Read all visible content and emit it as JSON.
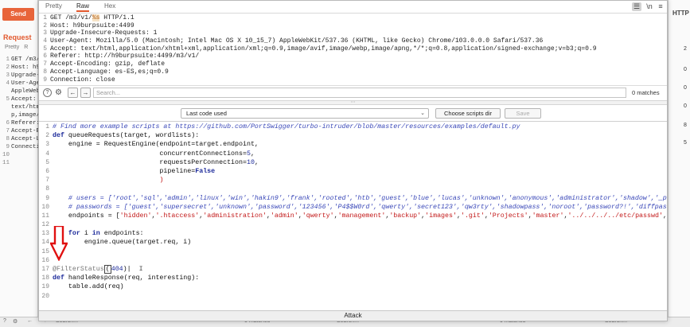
{
  "background": {
    "send_label": "Send",
    "request_label": "Request",
    "tabs": [
      "Pretty",
      "R"
    ],
    "lines": [
      {
        "n": "1",
        "t": "GET /m3/"
      },
      {
        "n": "2",
        "t": "Host: h9"
      },
      {
        "n": "3",
        "t": "Upgrade-"
      },
      {
        "n": "4",
        "t": "User-Age"
      },
      {
        "n": "",
        "t": "AppleWeb"
      },
      {
        "n": "5",
        "t": "Accept:"
      },
      {
        "n": "",
        "t": "text/htm"
      },
      {
        "n": "",
        "t": "p,image/"
      },
      {
        "n": "6",
        "t": "Referer:"
      },
      {
        "n": "7",
        "t": "Accept-E"
      },
      {
        "n": "8",
        "t": "Accept-L"
      },
      {
        "n": "9",
        "t": "Connecti"
      },
      {
        "n": "10",
        "t": ""
      },
      {
        "n": "11",
        "t": ""
      }
    ],
    "right_header": "HTTP",
    "right_numbers": [
      "2",
      "0",
      "0",
      "0",
      "8",
      "5"
    ],
    "bottom": {
      "search_left": "Search...",
      "matches_left": "0 matches",
      "search_right": "Search...",
      "matches_right": "0 matches",
      "search_far": "Search..."
    }
  },
  "modal": {
    "tabs": [
      "Pretty",
      "Raw",
      "Hex"
    ],
    "active_tab": "Raw",
    "toolbar_icons": [
      "list-icon",
      "newline-icon",
      "menu-icon"
    ],
    "toolbar_glyphs": [
      "☰",
      "\\n",
      "≡"
    ],
    "request_lines": [
      {
        "n": "1",
        "pre": "GET /m3/v1/",
        "hl": "%s",
        "post": " HTTP/1.1"
      },
      {
        "n": "2",
        "pre": "Host: h9burpsuite:4499",
        "hl": "",
        "post": ""
      },
      {
        "n": "3",
        "pre": "Upgrade-Insecure-Requests: 1",
        "hl": "",
        "post": ""
      },
      {
        "n": "4",
        "pre": "User-Agent: Mozilla/5.0 (Macintosh; Intel Mac OS X 10_15_7) AppleWebKit/537.36 (KHTML, like Gecko) Chrome/103.0.0.0 Safari/537.36",
        "hl": "",
        "post": ""
      },
      {
        "n": "5",
        "pre": "Accept: text/html,application/xhtml+xml,application/xml;q=0.9,image/avif,image/webp,image/apng,*/*;q=0.8,application/signed-exchange;v=b3;q=0.9",
        "hl": "",
        "post": ""
      },
      {
        "n": "6",
        "pre": "Referer: http://h9burpsuite:4499/m3/v1/",
        "hl": "",
        "post": ""
      },
      {
        "n": "7",
        "pre": "Accept-Encoding: gzip, deflate",
        "hl": "",
        "post": ""
      },
      {
        "n": "8",
        "pre": "Accept-Language: es-ES,es;q=0.9",
        "hl": "",
        "post": ""
      },
      {
        "n": "9",
        "pre": "Connection: close",
        "hl": "",
        "post": ""
      }
    ],
    "search": {
      "placeholder": "Search...",
      "matches": "0 matches"
    },
    "script_select": "Last code used",
    "choose_dir_label": "Choose scripts dir",
    "save_label": "Save",
    "code_lines": [
      {
        "n": "1",
        "html": "<span class=\"c-cm\"># Find more example scripts at https://github.com/PortSwigger/turbo-intruder/blob/master/resources/examples/default.py</span>"
      },
      {
        "n": "2",
        "html": "<span class=\"c-kw\">def</span> queueRequests(target, wordlists):"
      },
      {
        "n": "3",
        "html": "    engine = RequestEngine(endpoint=target.endpoint,"
      },
      {
        "n": "4",
        "html": "                           concurrentConnections=<span class=\"c-num\">5</span>,"
      },
      {
        "n": "5",
        "html": "                           requestsPerConnection=<span class=\"c-num\">10</span>,"
      },
      {
        "n": "6",
        "html": "                           pipeline=<span class=\"c-kw\">False</span>"
      },
      {
        "n": "7",
        "html": "                           <span class=\"c-neg\">)</span>"
      },
      {
        "n": "8",
        "html": ""
      },
      {
        "n": "9",
        "html": "    <span class=\"c-cm\"># users = ['root','sql','admin','linux','win','hakin9','frank','rooted','htb','guest','blue','lucas','unknown','anonymous','administrator','shadow','_p</span>"
      },
      {
        "n": "10",
        "html": "    <span class=\"c-cm\"># passwords = ['guest','supersecret','unknown','password','123456','P4$$W0rd','qwerty','secret123','qw3rty','shadowpass','noroot','password?!','diffpas</span>"
      },
      {
        "n": "11",
        "html": "    endpoints = [<span class=\"c-str\">'hidden'</span>,<span class=\"c-str\">'.htaccess'</span>,<span class=\"c-str\">'administration'</span>,<span class=\"c-str\">'admin'</span>,<span class=\"c-str\">'qwerty'</span>,<span class=\"c-str\">'management'</span>,<span class=\"c-str\">'backup'</span>,<span class=\"c-str\">'images'</span>,<span class=\"c-str\">'.git'</span>,<span class=\"c-str\">'Projects'</span>,<span class=\"c-str\">'master'</span>,<span class=\"c-str\">'../../../../etc/passwd'</span>,"
      },
      {
        "n": "12",
        "html": ""
      },
      {
        "n": "13",
        "html": "    <span class=\"c-kw\">for</span> i <span class=\"c-kw\">in</span> endpoints:"
      },
      {
        "n": "14",
        "html": "        engine.queue(target.req, i)"
      },
      {
        "n": "15",
        "html": ""
      },
      {
        "n": "16",
        "html": ""
      },
      {
        "n": "17",
        "html": "<span class=\"c-dec\">@FilterStatus</span><span class=\"cursor-box\">(</span><span class=\"c-num\">404</span>)|  <span style=\"color:#444\">I</span>"
      },
      {
        "n": "18",
        "html": "<span class=\"c-kw\">def</span> handleResponse(req, interesting):"
      },
      {
        "n": "19",
        "html": "    table.add(req)"
      },
      {
        "n": "20",
        "html": ""
      }
    ],
    "attack_label": "Attack"
  },
  "colors": {
    "accent": "#e8643a",
    "arrow": "#e01010"
  }
}
